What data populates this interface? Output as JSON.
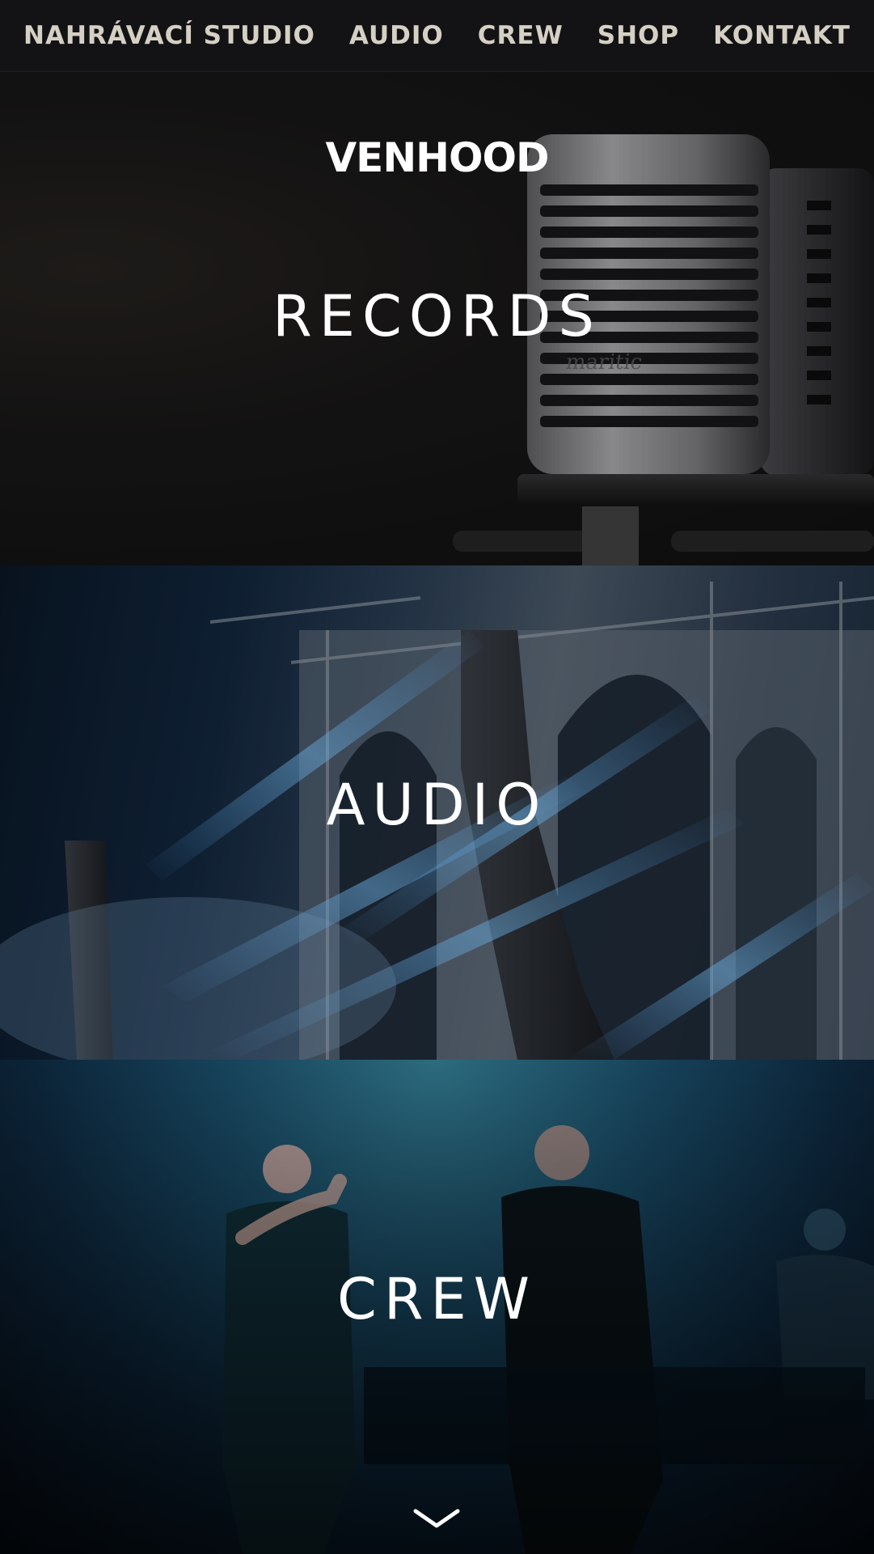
{
  "nav": {
    "items": [
      {
        "label": "NAHRÁVACÍ STUDIO"
      },
      {
        "label": "AUDIO"
      },
      {
        "label": "CREW"
      },
      {
        "label": "SHOP"
      },
      {
        "label": "KONTAKT"
      }
    ]
  },
  "records": {
    "logo": "VENHOOD",
    "mic_brand": "maritic",
    "title": "RECORDS"
  },
  "audio": {
    "title": "AUDIO"
  },
  "crew": {
    "title": "CREW"
  },
  "scroll_icon": "chevron-down-icon",
  "colors": {
    "nav_bg": "#131315",
    "nav_text": "#d6d0c4",
    "title_text": "#ffffff"
  }
}
